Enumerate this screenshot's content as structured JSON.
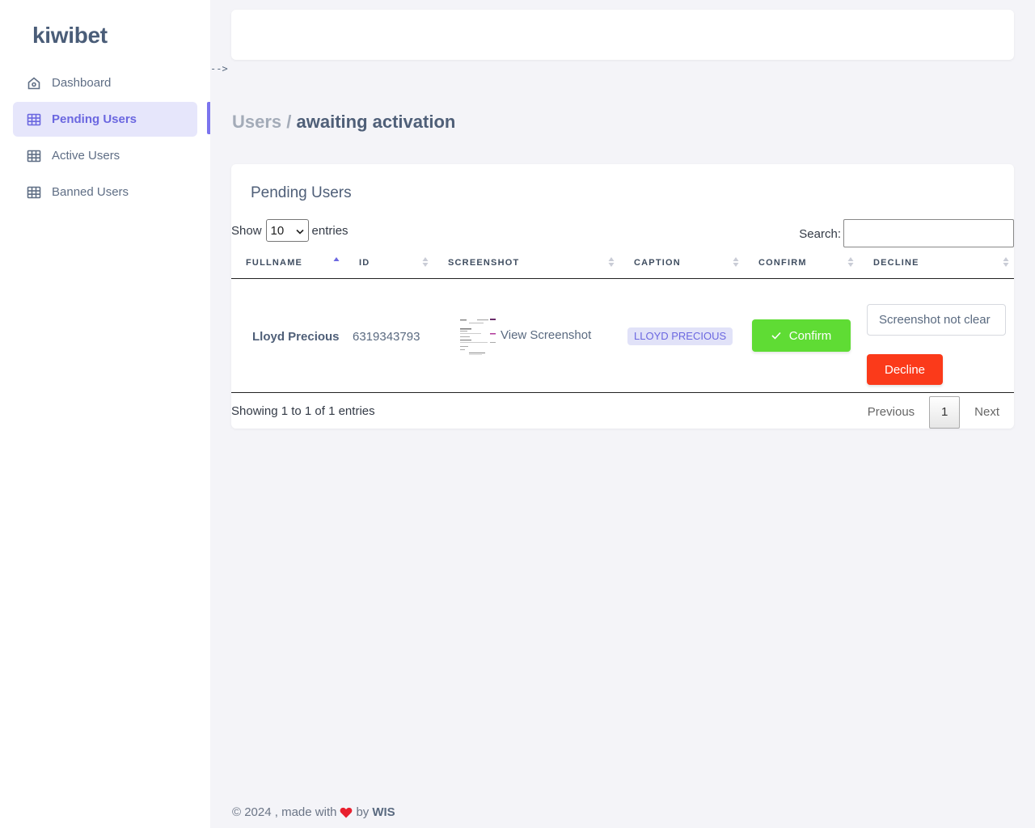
{
  "app": {
    "brand": "kiwibet"
  },
  "sidebar": {
    "items": [
      {
        "label": "Dashboard",
        "icon": "home-icon",
        "active": false
      },
      {
        "label": "Pending Users",
        "icon": "table-icon",
        "active": true
      },
      {
        "label": "Active Users",
        "icon": "table-icon",
        "active": false
      },
      {
        "label": "Banned Users",
        "icon": "table-icon",
        "active": false
      }
    ]
  },
  "stray_text": "-->",
  "breadcrumb": {
    "parent": "Users",
    "separator": " / ",
    "current": "awaiting activation"
  },
  "card": {
    "title": "Pending Users",
    "length": {
      "prefix": "Show",
      "value": "10",
      "suffix": "entries"
    },
    "search": {
      "label": "Search:",
      "value": ""
    },
    "columns": [
      "FULLNAME",
      "ID",
      "SCREENSHOT",
      "CAPTION",
      "CONFIRM",
      "DECLINE"
    ],
    "rows": [
      {
        "fullname": "Lloyd Precious",
        "id": "6319343793",
        "screenshot_link": "View Screenshot",
        "caption": "LLOYD PRECIOUS",
        "confirm_label": "Confirm",
        "decline_reason": "Screenshot not clear",
        "decline_label": "Decline"
      }
    ],
    "info": "Showing 1 to 1 of 1 entries",
    "pagination": {
      "previous": "Previous",
      "current_page": "1",
      "next": "Next"
    }
  },
  "footer": {
    "prefix": "© 2024 , made with",
    "by": "by",
    "author": "WIS"
  },
  "colors": {
    "accent": "#6b67e0",
    "confirm": "#5fdc34",
    "decline": "#fb3a1a",
    "heart": "#e8202e"
  }
}
